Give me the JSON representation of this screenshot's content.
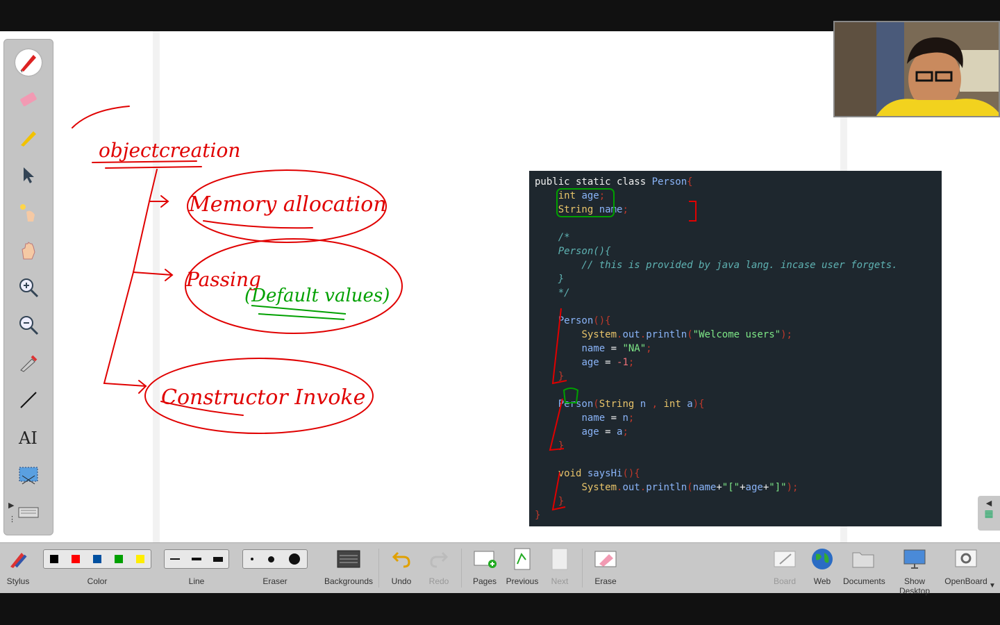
{
  "sidebar": {
    "tools": [
      "pen-icon",
      "eraser-icon",
      "highlighter-icon",
      "pointer-icon",
      "laser-icon",
      "hand-icon",
      "zoom-in-icon",
      "zoom-out-icon",
      "color-picker-icon",
      "line-icon",
      "text-icon",
      "capture-icon",
      "keyboard-icon"
    ]
  },
  "ink": {
    "title": "objectcreation",
    "items": [
      "Memory allocation",
      "Passing",
      "(Default values)",
      "Constructor Invoke"
    ]
  },
  "code_lines": [
    {
      "segs": [
        [
          "kw",
          "public static class "
        ],
        [
          "id",
          "Person"
        ],
        [
          "pn",
          "{"
        ]
      ]
    },
    {
      "segs": [
        [
          "kw",
          "    "
        ],
        [
          "ty",
          "int "
        ],
        [
          "id",
          "age"
        ],
        [
          "pn",
          ";"
        ]
      ]
    },
    {
      "segs": [
        [
          "kw",
          "    "
        ],
        [
          "ty",
          "String "
        ],
        [
          "id",
          "name"
        ],
        [
          "pn",
          ";"
        ]
      ]
    },
    {
      "segs": [
        [
          "kw",
          ""
        ]
      ]
    },
    {
      "segs": [
        [
          "cm",
          "    /*"
        ]
      ]
    },
    {
      "segs": [
        [
          "cm",
          "    Person(){"
        ]
      ]
    },
    {
      "segs": [
        [
          "cm",
          "        // this is provided by java lang. incase user forgets."
        ]
      ]
    },
    {
      "segs": [
        [
          "cm",
          "    }"
        ]
      ]
    },
    {
      "segs": [
        [
          "cm",
          "    */"
        ]
      ]
    },
    {
      "segs": [
        [
          "kw",
          ""
        ]
      ]
    },
    {
      "segs": [
        [
          "kw",
          "    "
        ],
        [
          "fn",
          "Person"
        ],
        [
          "pn",
          "(){"
        ]
      ]
    },
    {
      "segs": [
        [
          "kw",
          "        "
        ],
        [
          "ty",
          "System"
        ],
        [
          "pn",
          "."
        ],
        [
          "id",
          "out"
        ],
        [
          "pn",
          "."
        ],
        [
          "fn",
          "println"
        ],
        [
          "pn",
          "("
        ],
        [
          "str",
          "\"Welcome users\""
        ],
        [
          "pn",
          ");"
        ]
      ]
    },
    {
      "segs": [
        [
          "kw",
          "        "
        ],
        [
          "id",
          "name "
        ],
        [
          "kw",
          "= "
        ],
        [
          "str",
          "\"NA\""
        ],
        [
          "pn",
          ";"
        ]
      ]
    },
    {
      "segs": [
        [
          "kw",
          "        "
        ],
        [
          "id",
          "age "
        ],
        [
          "kw",
          "= "
        ],
        [
          "num",
          "-1"
        ],
        [
          "pn",
          ";"
        ]
      ]
    },
    {
      "segs": [
        [
          "kw",
          "    "
        ],
        [
          "pn",
          "}"
        ]
      ]
    },
    {
      "segs": [
        [
          "kw",
          ""
        ]
      ]
    },
    {
      "segs": [
        [
          "kw",
          "    "
        ],
        [
          "fn",
          "Person"
        ],
        [
          "pn",
          "("
        ],
        [
          "ty",
          "String "
        ],
        [
          "id",
          "n "
        ],
        [
          "pn",
          ", "
        ],
        [
          "ty",
          "int "
        ],
        [
          "id",
          "a"
        ],
        [
          "pn",
          "){"
        ]
      ]
    },
    {
      "segs": [
        [
          "kw",
          "        "
        ],
        [
          "id",
          "name "
        ],
        [
          "kw",
          "= "
        ],
        [
          "id",
          "n"
        ],
        [
          "pn",
          ";"
        ]
      ]
    },
    {
      "segs": [
        [
          "kw",
          "        "
        ],
        [
          "id",
          "age "
        ],
        [
          "kw",
          "= "
        ],
        [
          "id",
          "a"
        ],
        [
          "pn",
          ";"
        ]
      ]
    },
    {
      "segs": [
        [
          "kw",
          "    "
        ],
        [
          "pn",
          "}"
        ]
      ]
    },
    {
      "segs": [
        [
          "kw",
          ""
        ]
      ]
    },
    {
      "segs": [
        [
          "kw",
          "    "
        ],
        [
          "ty",
          "void "
        ],
        [
          "fn",
          "saysHi"
        ],
        [
          "pn",
          "(){"
        ]
      ]
    },
    {
      "segs": [
        [
          "kw",
          "        "
        ],
        [
          "ty",
          "System"
        ],
        [
          "pn",
          "."
        ],
        [
          "id",
          "out"
        ],
        [
          "pn",
          "."
        ],
        [
          "fn",
          "println"
        ],
        [
          "pn",
          "("
        ],
        [
          "id",
          "name"
        ],
        [
          "kw",
          "+"
        ],
        [
          "str",
          "\"[\""
        ],
        [
          "kw",
          "+"
        ],
        [
          "id",
          "age"
        ],
        [
          "kw",
          "+"
        ],
        [
          "str",
          "\"]\""
        ],
        [
          "pn",
          ");"
        ]
      ]
    },
    {
      "segs": [
        [
          "kw",
          "    "
        ],
        [
          "pn",
          "}"
        ]
      ]
    },
    {
      "segs": [
        [
          "pn",
          "}"
        ]
      ]
    }
  ],
  "bottom": {
    "stylus": "Stylus",
    "color": "Color",
    "line": "Line",
    "eraser": "Eraser",
    "backgrounds": "Backgrounds",
    "undo": "Undo",
    "redo": "Redo",
    "pages": "Pages",
    "previous": "Previous",
    "next": "Next",
    "erase": "Erase",
    "board": "Board",
    "web": "Web",
    "documents": "Documents",
    "show_desktop": "Show Desktop",
    "openboard": "OpenBoard"
  },
  "colors": {
    "swatches": [
      "#000000",
      "#ff0000",
      "#0050a0",
      "#00a000",
      "#ffee00"
    ],
    "ink_red": "#e00000",
    "ink_green": "#00a000"
  }
}
